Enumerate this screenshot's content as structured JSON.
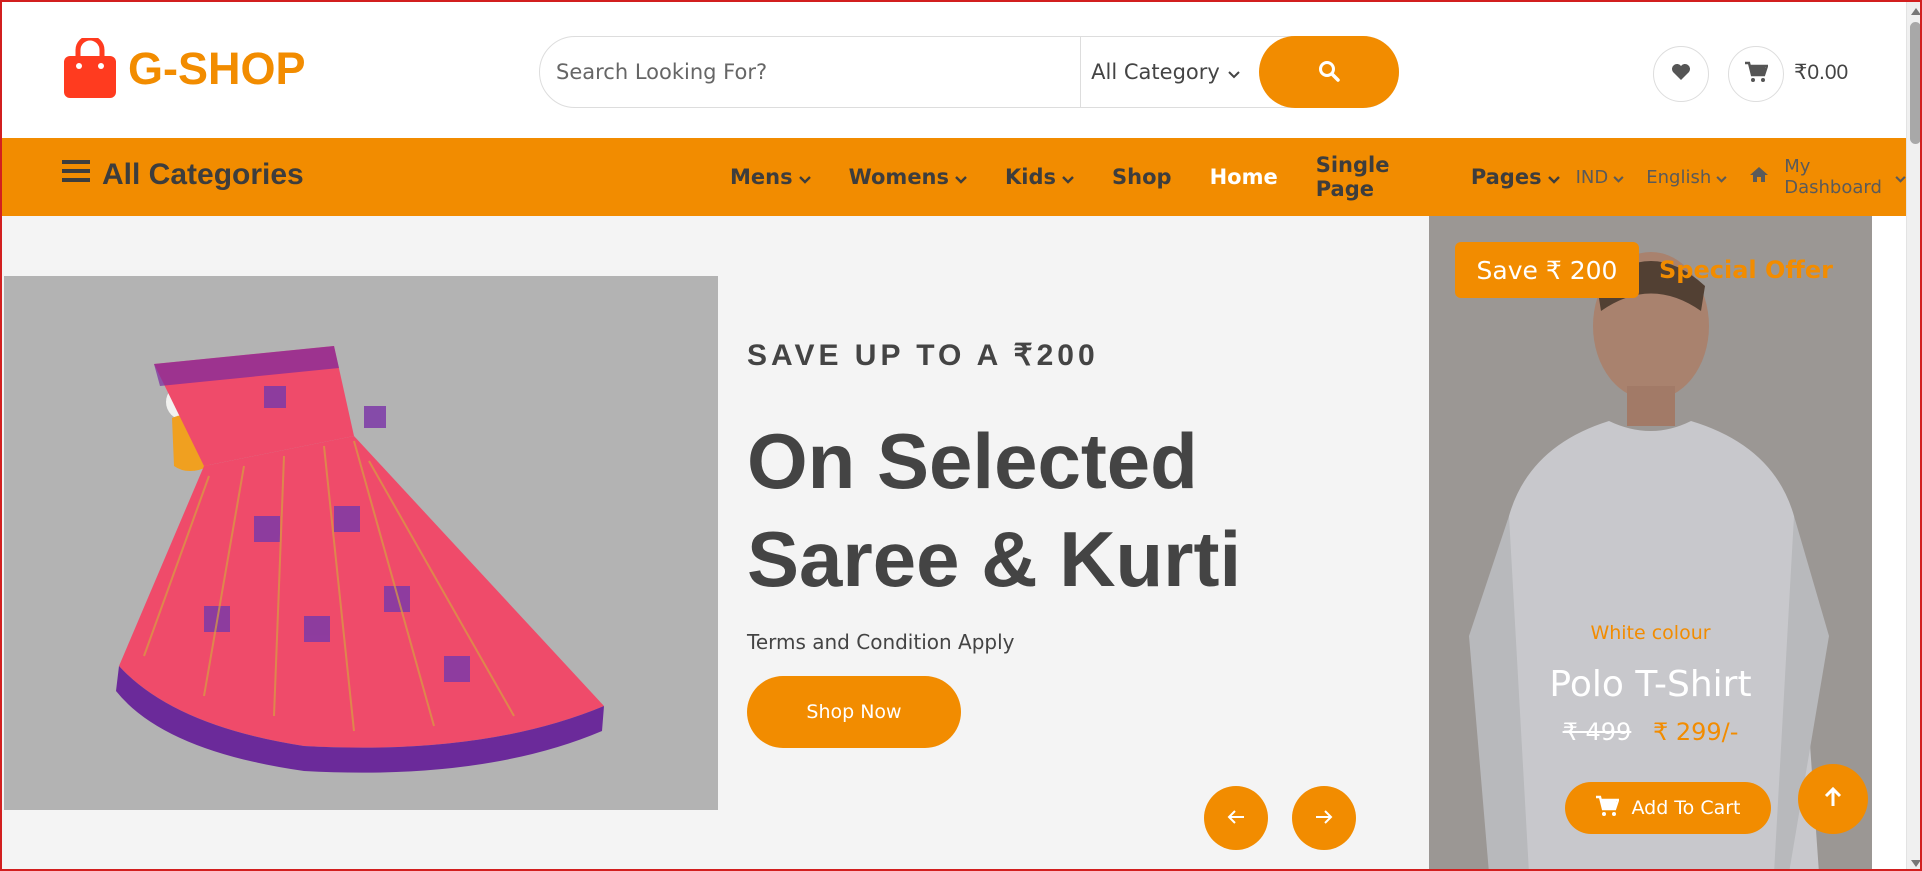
{
  "brand": {
    "name": "G-SHOP",
    "color": "#f28c00"
  },
  "search": {
    "placeholder": "Search Looking For?",
    "category": "All Category"
  },
  "header": {
    "cart_amount": "₹0.00"
  },
  "nav": {
    "all_categories": "All Categories",
    "items": [
      {
        "label": "Mens",
        "dropdown": true
      },
      {
        "label": "Womens",
        "dropdown": true
      },
      {
        "label": "Kids",
        "dropdown": true
      },
      {
        "label": "Shop",
        "dropdown": false
      },
      {
        "label": "Home",
        "dropdown": false,
        "active": true
      },
      {
        "label": "Single Page",
        "dropdown": false
      },
      {
        "label": "Pages",
        "dropdown": true
      }
    ],
    "currency": "IND",
    "language": "English",
    "dashboard": "My Dashboard"
  },
  "hero": {
    "subtitle": "SAVE UP TO A ₹200",
    "title_line1": "On Selected",
    "title_line2": "Saree & Kurti",
    "terms": "Terms and Condition Apply",
    "button": "Shop Now"
  },
  "offer": {
    "badge": "Save ₹ 200",
    "label": "Special Offer",
    "colour": "White colour",
    "product": "Polo T-Shirt",
    "old_price": "₹ 499",
    "new_price": "₹ 299/-",
    "button": "Add To Cart"
  },
  "icons": [
    "shopping-bag-icon",
    "search-icon",
    "chevron-down-icon",
    "heart-icon",
    "cart-icon",
    "menu-icon",
    "home-icon",
    "arrow-left-icon",
    "arrow-right-icon",
    "arrow-up-icon"
  ]
}
